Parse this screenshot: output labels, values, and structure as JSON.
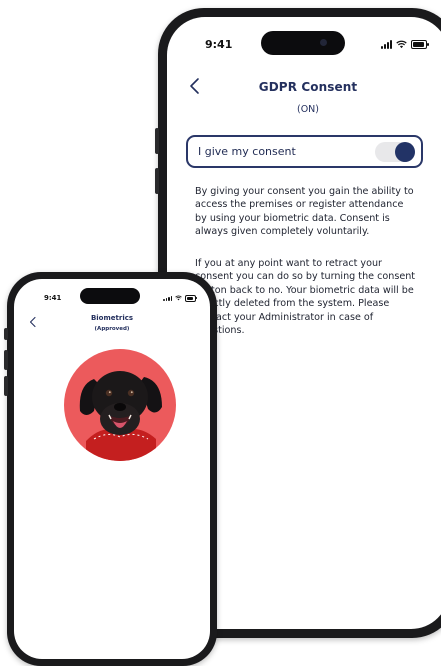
{
  "gdpr_screen": {
    "time": "9:41",
    "title": "GDPR Consent",
    "subtitle": "(ON)",
    "consent_label": "I give my consent",
    "consent_enabled": true,
    "paragraph_1": "By giving your consent you gain the ability to access the premises or register attendance by using your biometric data. Consent is always given completely voluntarily.",
    "paragraph_2": "If you at any point want to retract your consent you can do so by turning the consent button back to no. Your biometric data will be directly deleted from the system. Please contact your Administrator in case of questions."
  },
  "biometrics_screen": {
    "time": "9:41",
    "title": "Biometrics",
    "subtitle": "(Approved)",
    "photo_icon": "dog-photo",
    "photo_background": "#ec5a5c"
  },
  "colors": {
    "accent": "#223366",
    "title": "#24305e",
    "toggle_track": "#e8e8ea"
  }
}
